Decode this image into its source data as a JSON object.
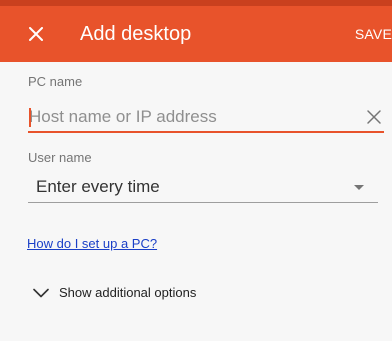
{
  "toolbar": {
    "title": "Add desktop",
    "save_label": "SAVE",
    "close_icon": "close-icon"
  },
  "pc_name": {
    "label": "PC name",
    "placeholder": "Host name or IP address",
    "value": "",
    "clear_icon": "clear-icon"
  },
  "user_name": {
    "label": "User name",
    "selected": "Enter every time",
    "dropdown_icon": "dropdown-arrow-icon"
  },
  "help_link": "How do I set up a PC?",
  "options_toggle": {
    "label": "Show additional options",
    "icon": "chevron-down-icon"
  },
  "colors": {
    "accent": "#e8532b",
    "accent_dark": "#c9401e",
    "link": "#1a3fc7",
    "background": "#f7f7f7"
  }
}
